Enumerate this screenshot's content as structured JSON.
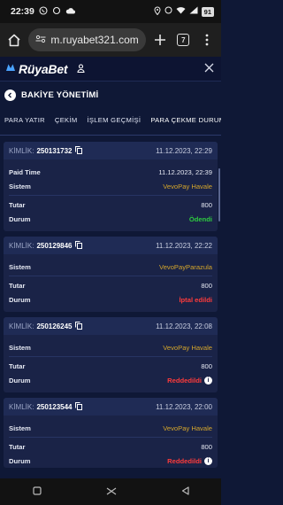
{
  "status": {
    "time": "22:39",
    "battery": "91"
  },
  "browser": {
    "url": "m.ruyabet321.com",
    "tab_count": "7"
  },
  "app": {
    "logo_text": "RüyaBet"
  },
  "page": {
    "title": "BAKİYE YÖNETİMİ"
  },
  "tabs": [
    {
      "label": "PARA YATIR"
    },
    {
      "label": "ÇEKİM"
    },
    {
      "label": "İŞLEM GEÇMİŞİ"
    },
    {
      "label": "PARA ÇEKME DURUMU"
    }
  ],
  "labels": {
    "kimlik": "KİMLİK:",
    "paid_time": "Paid Time",
    "sistem": "Sistem",
    "tutar": "Tutar",
    "durum": "Durum"
  },
  "transactions": [
    {
      "id": "250131732",
      "date": "11.12.2023, 22:29",
      "paid_time": "11.12.2023, 22:39",
      "system": "VevoPay Havale",
      "amount": "800",
      "status": "Ödendi"
    },
    {
      "id": "250129846",
      "date": "11.12.2023, 22:22",
      "system": "VevoPayParazula",
      "amount": "800",
      "status": "İptal edildi"
    },
    {
      "id": "250126245",
      "date": "11.12.2023, 22:08",
      "system": "VevoPay Havale",
      "amount": "800",
      "status": "Reddedildi"
    },
    {
      "id": "250123544",
      "date": "11.12.2023, 22:00",
      "system": "VevoPay Havale",
      "amount": "800",
      "status": "Reddedildi"
    }
  ],
  "colors": {
    "background": "#0f1836",
    "card": "#1a2347",
    "gold": "#d4a52b",
    "green": "#2ecc40",
    "red": "#ff3b3b"
  }
}
